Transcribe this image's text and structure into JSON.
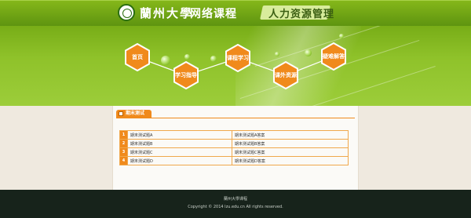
{
  "header": {
    "university": "蘭州大學",
    "site": "网络课程",
    "course_title": "人力资源管理"
  },
  "nav": {
    "items": [
      {
        "label": "首页"
      },
      {
        "label": "学习指导"
      },
      {
        "label": "课程学习"
      },
      {
        "label": "课外资源"
      },
      {
        "label": "疑难解答"
      }
    ]
  },
  "section": {
    "tab_label": "期末测试"
  },
  "quiz": {
    "rows": [
      {
        "num": "1",
        "question": "期末测试题A",
        "answer": "期末测试题A答案"
      },
      {
        "num": "2",
        "question": "期末测试题B",
        "answer": "期末测试题B答案"
      },
      {
        "num": "3",
        "question": "期末测试题C",
        "answer": "期末测试题C答案"
      },
      {
        "num": "4",
        "question": "期末测试题D",
        "answer": "期末测试题D答案"
      }
    ]
  },
  "footer": {
    "line1": "蘭州大學课程",
    "line2": "Copyright © 2014 lzu.edu.cn    All rights reserved."
  },
  "colors": {
    "header_green": "#6fa514",
    "hex_orange": "#f08a1c",
    "footer_dark": "#17231b"
  }
}
